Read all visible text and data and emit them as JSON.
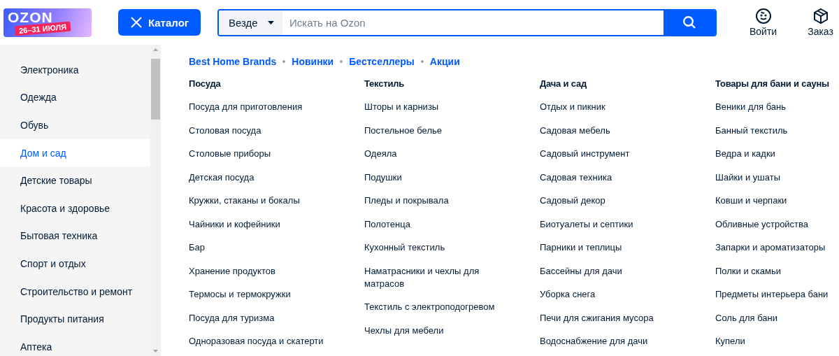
{
  "header": {
    "logo": {
      "brand": "OZON",
      "promo": "26–31 ИЮЛЯ"
    },
    "catalog_button": "Каталог",
    "search": {
      "scope": "Везде",
      "placeholder": "Искать на Ozon"
    },
    "actions": [
      {
        "kind": "login",
        "label": "Войти"
      },
      {
        "kind": "orders",
        "label": "Заказ"
      }
    ]
  },
  "sidebar": {
    "items": [
      {
        "label": "Электроника",
        "selected": false
      },
      {
        "label": "Одежда",
        "selected": false
      },
      {
        "label": "Обувь",
        "selected": false
      },
      {
        "label": "Дом и сад",
        "selected": true
      },
      {
        "label": "Детские товары",
        "selected": false
      },
      {
        "label": "Красота и здоровье",
        "selected": false
      },
      {
        "label": "Бытовая техника",
        "selected": false
      },
      {
        "label": "Спорт и отдых",
        "selected": false
      },
      {
        "label": "Строительство и ремонт",
        "selected": false
      },
      {
        "label": "Продукты питания",
        "selected": false
      },
      {
        "label": "Аптека",
        "selected": false
      }
    ]
  },
  "quick_links": [
    "Best Home Brands",
    "Новинки",
    "Бестселлеры",
    "Акции"
  ],
  "columns": [
    {
      "title": "Посуда",
      "items": [
        "Посуда для приготовления",
        "Столовая посуда",
        "Столовые приборы",
        "Детская посуда",
        "Кружки, стаканы и бокалы",
        "Чайники и кофейники",
        "Бар",
        "Хранение продуктов",
        "Термосы и термокружки",
        "Посуда для туризма",
        "Одноразовая посуда и скатерти"
      ]
    },
    {
      "title": "Текстиль",
      "items": [
        "Шторы и карнизы",
        "Постельное белье",
        "Одеяла",
        "Подушки",
        "Пледы и покрывала",
        "Полотенца",
        "Кухонный текстиль",
        "Наматрасники и чехлы для матрасов",
        "Текстиль с электроподогревом",
        "Чехлы для мебели"
      ]
    },
    {
      "title": "Дача и сад",
      "items": [
        "Отдых и пикник",
        "Садовая мебель",
        "Садовый инструмент",
        "Садовая техника",
        "Садовый декор",
        "Биотуалеты и септики",
        "Парники и теплицы",
        "Бассейны для дачи",
        "Уборка снега",
        "Печи для сжигания мусора",
        "Водоснабжение для дачи"
      ]
    },
    {
      "title": "Товары для бани и сауны",
      "items": [
        "Веники для бань",
        "Банный текстиль",
        "Ведра и кадки",
        "Шайки и ушаты",
        "Ковши и черпаки",
        "Обливные устройства",
        "Запарки и ароматизаторы",
        "Полки и скамьи",
        "Предметы интерьера бани",
        "Соль для бани",
        "Купели"
      ]
    }
  ]
}
